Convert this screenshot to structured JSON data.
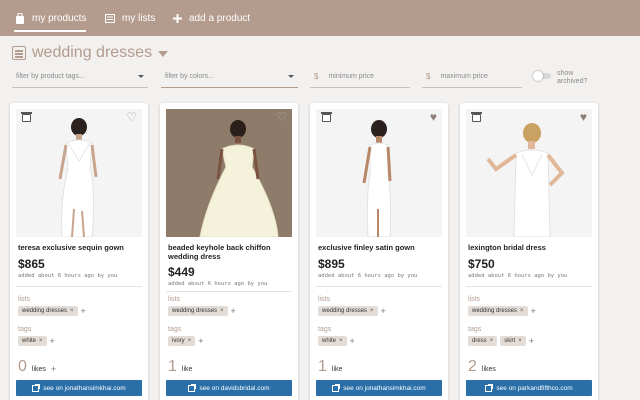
{
  "nav": {
    "items": [
      {
        "label": "my products",
        "icon": "bag-icon"
      },
      {
        "label": "my lists",
        "icon": "list-icon"
      },
      {
        "label": "add a product",
        "icon": "plus-icon"
      }
    ]
  },
  "list": {
    "title": "wedding dresses"
  },
  "filters": {
    "tags_placeholder": "filter by product tags...",
    "colors_placeholder": "filter by colors...",
    "min_price_placeholder": "minimum price",
    "max_price_placeholder": "maximum price",
    "currency_symbol": "$",
    "archived_label": "show archived?"
  },
  "colors": {
    "nav_bg": "#b39b8e",
    "accent": "#b39b8e",
    "button": "#2a6fa8",
    "chip": "#e4dcd6"
  },
  "card_labels": {
    "lists": "lists",
    "tags": "tags"
  },
  "products": [
    {
      "name": "teresa exclusive sequin gown",
      "price": "$865",
      "added": "added about 6 hours ago by you",
      "lists": [
        "wedding dresses"
      ],
      "tags": [
        "white"
      ],
      "likes_count": "0",
      "likes_label": "likes",
      "liked": false,
      "store": "see on jonathansimkhai.com"
    },
    {
      "name": "beaded keyhole back chiffon wedding dress",
      "price": "$449",
      "added": "added about 6 hours ago by you",
      "lists": [
        "wedding dresses"
      ],
      "tags": [
        "ivory"
      ],
      "likes_count": "1",
      "likes_label": "like",
      "liked": false,
      "store": "see on davidsbridal.com"
    },
    {
      "name": "exclusive finley satin gown",
      "price": "$895",
      "added": "added about 6 hours ago by you",
      "lists": [
        "wedding dresses"
      ],
      "tags": [
        "white"
      ],
      "likes_count": "1",
      "likes_label": "like",
      "liked": true,
      "store": "see on jonathansimkhai.com"
    },
    {
      "name": "lexington bridal dress",
      "price": "$750",
      "added": "added about 6 hours ago by you",
      "lists": [
        "wedding dresses"
      ],
      "tags": [
        "dress",
        "skirt"
      ],
      "likes_count": "2",
      "likes_label": "likes",
      "liked": true,
      "store": "see on parkandfifthco.com"
    }
  ]
}
